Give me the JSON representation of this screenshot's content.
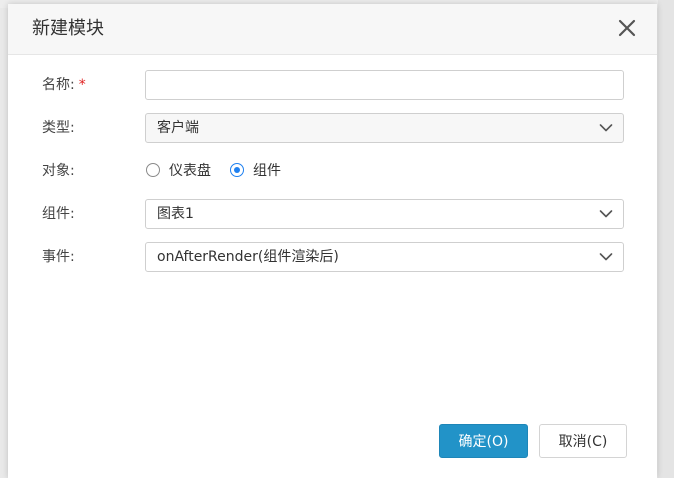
{
  "dialog": {
    "title": "新建模块",
    "close_icon": "close-icon"
  },
  "form": {
    "name": {
      "label": "名称:",
      "required_mark": "*",
      "value": "",
      "placeholder": ""
    },
    "type": {
      "label": "类型:",
      "value": "客户端"
    },
    "target": {
      "label": "对象:",
      "options": [
        {
          "label": "仪表盘",
          "checked": false
        },
        {
          "label": "组件",
          "checked": true
        }
      ]
    },
    "component": {
      "label": "组件:",
      "value": "图表1"
    },
    "event": {
      "label": "事件:",
      "value": "onAfterRender(组件渲染后)"
    }
  },
  "buttons": {
    "confirm": "确定(O)",
    "cancel": "取消(C)"
  },
  "colors": {
    "primary": "#2293c8",
    "radio_accent": "#1f80f0",
    "required": "#e02020"
  }
}
